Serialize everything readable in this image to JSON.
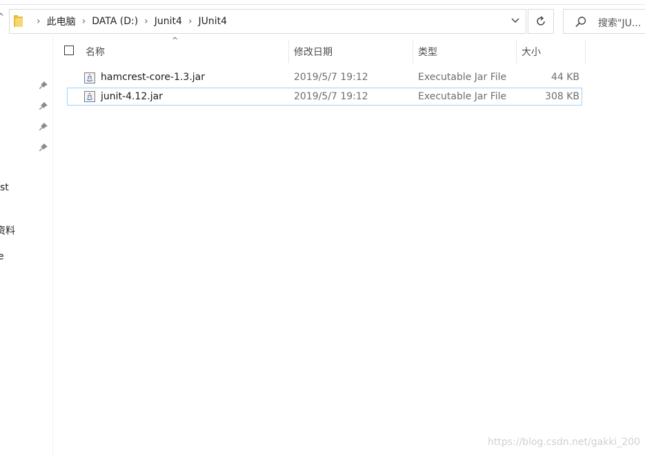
{
  "address_bar": {
    "breadcrumbs": [
      "此电脑",
      "DATA (D:)",
      "Junit4",
      "JUnit4"
    ]
  },
  "search": {
    "placeholder": "搜索\"JU..."
  },
  "nav_pane": {
    "partial_items": [
      "st",
      "资料",
      "e"
    ]
  },
  "columns": {
    "name": "名称",
    "date": "修改日期",
    "type": "类型",
    "size": "大小"
  },
  "files": [
    {
      "name": "hamcrest-core-1.3.jar",
      "date": "2019/5/7 19:12",
      "type": "Executable Jar File",
      "size": "44 KB"
    },
    {
      "name": "junit-4.12.jar",
      "date": "2019/5/7 19:12",
      "type": "Executable Jar File",
      "size": "308 KB"
    }
  ],
  "watermark": "https://blog.csdn.net/gakki_200"
}
